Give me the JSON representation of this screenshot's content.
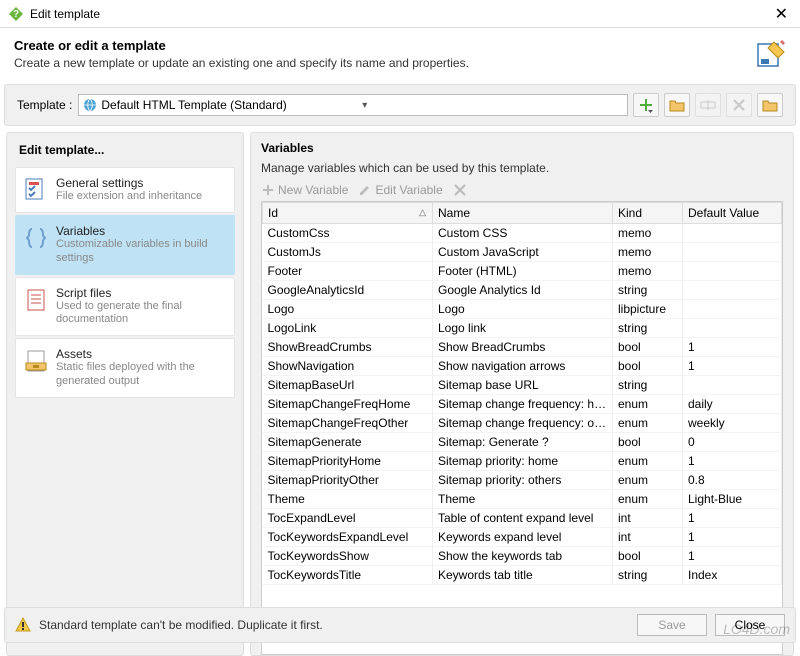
{
  "window": {
    "title": "Edit template"
  },
  "header": {
    "title": "Create or edit a template",
    "subtitle": "Create a new template or update an existing one and specify its name and properties."
  },
  "templateRow": {
    "label": "Template :",
    "selected": "Default HTML Template (Standard)"
  },
  "sidebar": {
    "title": "Edit template...",
    "items": [
      {
        "title": "General settings",
        "sub": "File extension and inheritance"
      },
      {
        "title": "Variables",
        "sub": "Customizable variables in build settings"
      },
      {
        "title": "Script files",
        "sub": "Used to generate the final documentation"
      },
      {
        "title": "Assets",
        "sub": "Static files deployed with the generated output"
      }
    ]
  },
  "content": {
    "title": "Variables",
    "sub": "Manage variables which can be used by this template.",
    "toolbar": {
      "new": "New Variable",
      "edit": "Edit Variable"
    },
    "columns": {
      "id": "Id",
      "name": "Name",
      "kind": "Kind",
      "default": "Default Value"
    },
    "rows": [
      {
        "id": "CustomCss",
        "name": "Custom CSS",
        "kind": "memo",
        "def": ""
      },
      {
        "id": "CustomJs",
        "name": "Custom JavaScript",
        "kind": "memo",
        "def": ""
      },
      {
        "id": "Footer",
        "name": "Footer (HTML)",
        "kind": "memo",
        "def": ""
      },
      {
        "id": "GoogleAnalyticsId",
        "name": "Google Analytics Id",
        "kind": "string",
        "def": ""
      },
      {
        "id": "Logo",
        "name": "Logo",
        "kind": "libpicture",
        "def": ""
      },
      {
        "id": "LogoLink",
        "name": "Logo link",
        "kind": "string",
        "def": ""
      },
      {
        "id": "ShowBreadCrumbs",
        "name": "Show BreadCrumbs",
        "kind": "bool",
        "def": "1"
      },
      {
        "id": "ShowNavigation",
        "name": "Show navigation arrows",
        "kind": "bool",
        "def": "1"
      },
      {
        "id": "SitemapBaseUrl",
        "name": "Sitemap base URL",
        "kind": "string",
        "def": ""
      },
      {
        "id": "SitemapChangeFreqHome",
        "name": "Sitemap change frequency: home",
        "kind": "enum",
        "def": "daily"
      },
      {
        "id": "SitemapChangeFreqOther",
        "name": "Sitemap change frequency: other",
        "kind": "enum",
        "def": "weekly"
      },
      {
        "id": "SitemapGenerate",
        "name": "Sitemap: Generate ?",
        "kind": "bool",
        "def": "0"
      },
      {
        "id": "SitemapPriorityHome",
        "name": "Sitemap priority: home",
        "kind": "enum",
        "def": "1"
      },
      {
        "id": "SitemapPriorityOther",
        "name": "Sitemap priority: others",
        "kind": "enum",
        "def": "0.8"
      },
      {
        "id": "Theme",
        "name": "Theme",
        "kind": "enum",
        "def": "Light-Blue"
      },
      {
        "id": "TocExpandLevel",
        "name": "Table of content expand level",
        "kind": "int",
        "def": "1"
      },
      {
        "id": "TocKeywordsExpandLevel",
        "name": "Keywords expand level",
        "kind": "int",
        "def": "1"
      },
      {
        "id": "TocKeywordsShow",
        "name": "Show the keywords tab",
        "kind": "bool",
        "def": "1"
      },
      {
        "id": "TocKeywordsTitle",
        "name": "Keywords tab title",
        "kind": "string",
        "def": "Index"
      }
    ]
  },
  "footer": {
    "message": "Standard template can't be modified. Duplicate it first.",
    "save": "Save",
    "close": "Close"
  },
  "watermark": "LO4D.com"
}
